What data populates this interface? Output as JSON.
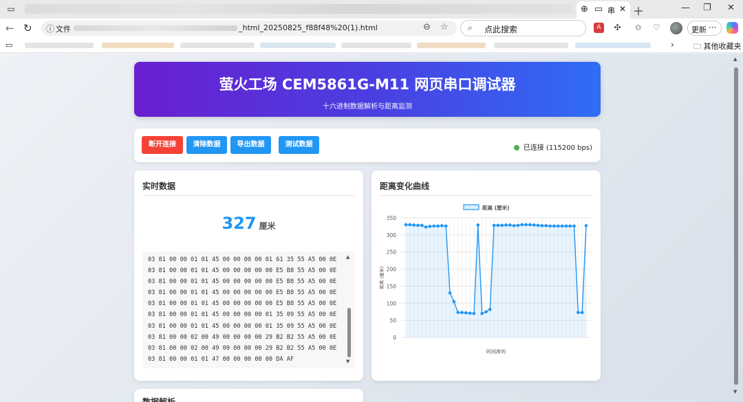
{
  "browser": {
    "active_tab_title": "串",
    "url_label": "文件",
    "url_visible": "_html_20250825_f88f48%20(1).html",
    "search_placeholder": "点此搜索",
    "update_label": "更新",
    "bookmark_other": "其他收藏夹"
  },
  "header": {
    "title": "萤火工场 CEM5861G-M11 网页串口调试器",
    "subtitle": "十六进制数据解析与距离监测"
  },
  "controls": {
    "disconnect": "断开连接",
    "clear": "清除数据",
    "export": "导出数据",
    "test": "测试数据",
    "status": "已连接 (115200 bps)"
  },
  "realtime": {
    "title": "实时数据",
    "value": "327",
    "unit": "厘米",
    "hex_log": "03 81 00 00 01 01 45 00 00 00 00 01 61 35 55 A5 00 0E 03 81 00 00 01 01 45 00 00 00 00 00 E5 B8 55 A5 00 0E 03 81 00 00 01 01 45 00 00 00 00 00 E5 B8 55 A5 00 0E 03 81 00 00 01 01 45 00 00 00 00 00 E5 B8 55 A5 00 0E 03 81 00 00 01 01 45 00 00 00 00 00 E5 B8 55 A5 00 0E 03 81 00 00 01 01 45 00 00 00 00 01 35 09 55 A5 00 0E 03 81 00 00 01 01 45 00 00 00 00 01 35 09 55 A5 00 0E 03 81 00 00 02 00 49 00 00 00 00 29 B2 B2 55 A5 00 0E 03 81 00 00 02 00 49 00 00 00 00 29 B2 B2 55 A5 00 0E 03 81 00 00 01 01 47 00 00 00 00 00 DA AF"
  },
  "chart_card": {
    "title": "距离变化曲线"
  },
  "next_card": {
    "title": "数据解析"
  },
  "chart_data": {
    "type": "line",
    "legend": "距离 (厘米)",
    "xlabel": "时间序列",
    "ylabel": "距离 (厘米)",
    "ylim": [
      0,
      350
    ],
    "yticks": [
      0,
      50,
      100,
      150,
      200,
      250,
      300,
      350
    ],
    "series": [
      {
        "name": "距离 (厘米)",
        "color": "#2196f3",
        "values": [
          330,
          330,
          329,
          328,
          328,
          323,
          325,
          326,
          326,
          327,
          326,
          130,
          105,
          73,
          73,
          72,
          71,
          70,
          329,
          70,
          75,
          82,
          328,
          328,
          328,
          329,
          329,
          327,
          328,
          330,
          330,
          330,
          329,
          328,
          327,
          327,
          326,
          326,
          326,
          326,
          326,
          326,
          326,
          73,
          73,
          327
        ]
      }
    ]
  }
}
